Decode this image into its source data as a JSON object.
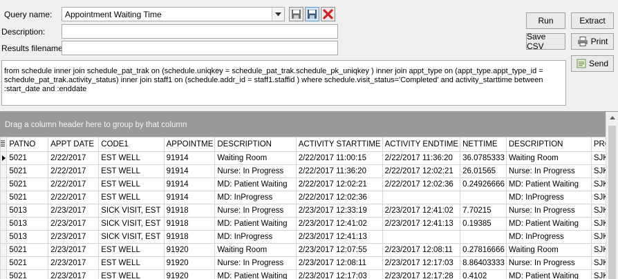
{
  "form": {
    "query_name_label": "Query name:",
    "query_name_value": "Appointment Waiting Time",
    "description_label": "Description:",
    "description_value": "",
    "results_filename_label": "Results filename:",
    "results_filename_value": ""
  },
  "buttons": {
    "run": "Run",
    "extract": "Extract",
    "save_csv": "Save CSV",
    "print": "Print",
    "send": "Send"
  },
  "sql": "from schedule inner join schedule_pat_trak on (schedule.uniqkey = schedule_pat_trak.schedule_pk_uniqkey ) inner join appt_type on (appt_type.appt_type_id = schedule_pat_trak.activity_status) inner join staff1 on (schedule.addr_id = staff1.staffid ) where schedule.visit_status='Completed' and activity_starttime between :start_date and :enddate",
  "grid": {
    "group_hint": "Drag a column header here to group by that column",
    "columns": [
      "PATNO",
      "APPT DATE",
      "CODE1",
      "APPOINTME",
      "DESCRIPTION",
      "ACTIVITY STARTTIME",
      "ACTIVITY ENDTIME",
      "NETTIME",
      "DESCRIPTION",
      "PRO"
    ],
    "rows": [
      [
        "5021",
        "2/22/2017",
        "EST WELL",
        "91914",
        "Waiting Room",
        "2/22/2017 11:00:15",
        "2/22/2017 11:36:20",
        "36.0785333",
        "Waiting Room",
        "SJK"
      ],
      [
        "5021",
        "2/22/2017",
        "EST WELL",
        "91914",
        "Nurse: In Progress",
        "2/22/2017 11:36:20",
        "2/22/2017 12:02:21",
        "26.01565",
        "Nurse: In Progress",
        "SJK"
      ],
      [
        "5021",
        "2/22/2017",
        "EST WELL",
        "91914",
        "MD: Patient Waiting",
        "2/22/2017 12:02:21",
        "2/22/2017 12:02:36",
        "0.24926666",
        "MD: Patient Waiting",
        "SJK"
      ],
      [
        "5021",
        "2/22/2017",
        "EST WELL",
        "91914",
        "MD: InProgress",
        "2/22/2017 12:02:36",
        "",
        "",
        "MD: InProgress",
        "SJK"
      ],
      [
        "5013",
        "2/23/2017",
        "SICK VISIT, EST",
        "91918",
        "Nurse: In Progress",
        "2/23/2017 12:33:19",
        "2/23/2017 12:41:02",
        "7.70215",
        "Nurse: In Progress",
        "SJK"
      ],
      [
        "5013",
        "2/23/2017",
        "SICK VISIT, EST",
        "91918",
        "MD: Patient Waiting",
        "2/23/2017 12:41:02",
        "2/23/2017 12:41:13",
        "0.19385",
        "MD: Patient Waiting",
        "SJK"
      ],
      [
        "5013",
        "2/23/2017",
        "SICK VISIT, EST",
        "91918",
        "MD: InProgress",
        "2/23/2017 12:41:13",
        "",
        "",
        "MD: InProgress",
        "SJK"
      ],
      [
        "5021",
        "2/23/2017",
        "EST WELL",
        "91920",
        "Waiting Room",
        "2/23/2017 12:07:55",
        "2/23/2017 12:08:11",
        "0.27816666",
        "Waiting Room",
        "SJK"
      ],
      [
        "5021",
        "2/23/2017",
        "EST WELL",
        "91920",
        "Nurse: In Progress",
        "2/23/2017 12:08:11",
        "2/23/2017 12:17:03",
        "8.86403333",
        "Nurse: In Progress",
        "SJK"
      ],
      [
        "5021",
        "2/23/2017",
        "EST WELL",
        "91920",
        "MD: Patient Waiting",
        "2/23/2017 12:17:03",
        "2/23/2017 12:17:28",
        "0.4102",
        "MD: Patient Waiting",
        "SJK"
      ]
    ]
  },
  "icons": {
    "save": "floppy-disk-icon",
    "save_as": "floppy-disk-edit-icon",
    "delete": "red-x-icon",
    "print": "printer-icon",
    "send": "send-icon",
    "row_pointer": "row-pointer-icon"
  },
  "colors": {
    "group_bar": "#999999",
    "delete_red": "#d42020",
    "selected_button": "#cfe4f7"
  }
}
